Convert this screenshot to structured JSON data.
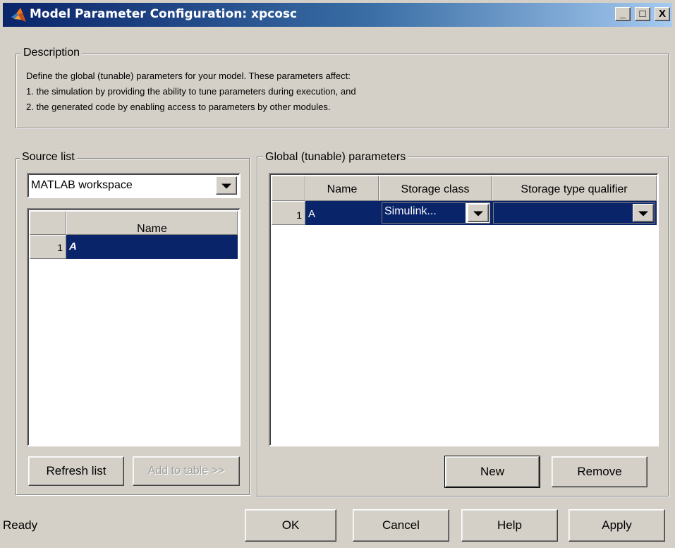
{
  "window": {
    "title": "Model Parameter Configuration: xpcosc",
    "minimize": "_",
    "maximize": "□",
    "close": "X"
  },
  "description": {
    "legend": "Description",
    "lines": [
      "Define the global (tunable) parameters for your model. These parameters affect:",
      "1. the simulation by providing the ability to tune parameters during execution, and",
      "2. the generated code by enabling access to parameters by other modules."
    ]
  },
  "source_list": {
    "legend": "Source list",
    "selected": "MATLAB workspace",
    "table": {
      "header_name": "Name",
      "rows": [
        {
          "index": "1",
          "name": "A"
        }
      ]
    },
    "refresh_label": "Refresh list",
    "add_label": "Add to table >>"
  },
  "global_params": {
    "legend": "Global (tunable) parameters",
    "columns": [
      "Name",
      "Storage class",
      "Storage type qualifier"
    ],
    "rows": [
      {
        "index": "1",
        "name": "A",
        "storage_class": "Simulink...",
        "qualifier": ""
      }
    ],
    "new_label": "New",
    "remove_label": "Remove"
  },
  "status": "Ready",
  "footer": {
    "ok_label": "OK",
    "cancel_label": "Cancel",
    "help_label": "Help",
    "apply_label": "Apply"
  },
  "colors": {
    "selection": "#0a246a",
    "title_start": "#0a246a",
    "title_end": "#a6caf0",
    "face": "#d4d0c8"
  },
  "icons": {
    "app": "matlab-logo-icon",
    "dropdown": "chevron-down-icon"
  }
}
